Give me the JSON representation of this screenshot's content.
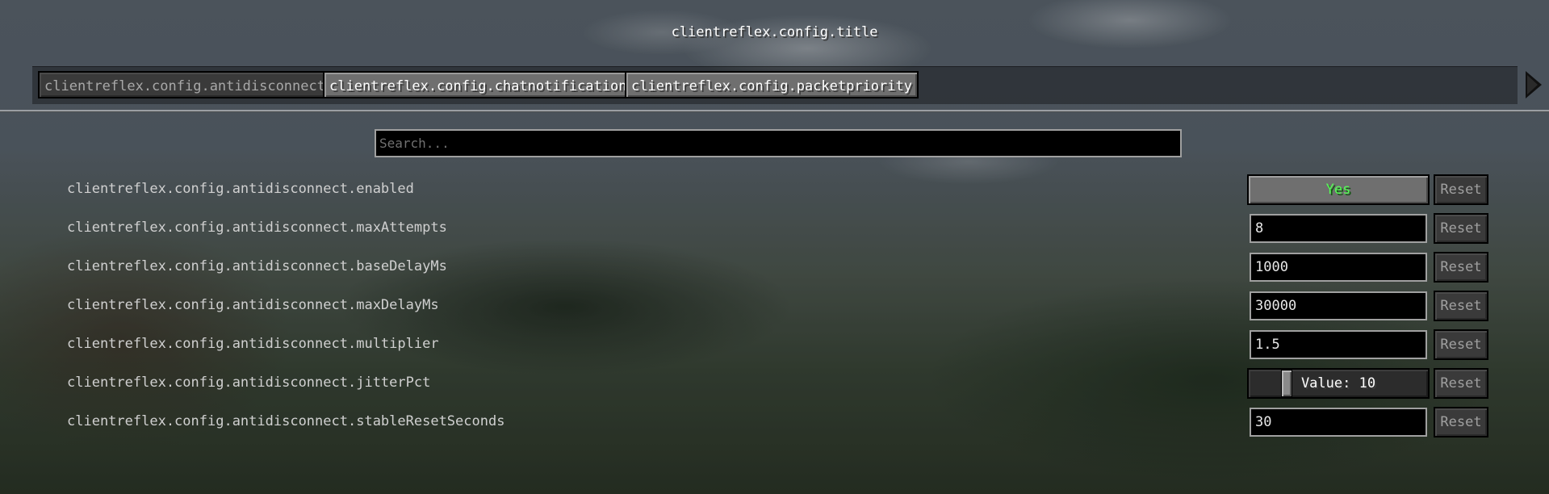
{
  "window": {
    "title": "clientreflex.config.title"
  },
  "tabs": [
    {
      "label": "clientreflex.config.antidisconnect",
      "active": true
    },
    {
      "label": "clientreflex.config.chatnotifications",
      "active": false
    },
    {
      "label": "clientreflex.config.packetpriority",
      "active": false
    }
  ],
  "search": {
    "placeholder": "Search...",
    "value": ""
  },
  "options": [
    {
      "label": "clientreflex.config.antidisconnect.enabled",
      "type": "toggle",
      "value": "Yes",
      "reset": "Reset"
    },
    {
      "label": "clientreflex.config.antidisconnect.maxAttempts",
      "type": "field",
      "value": "8",
      "reset": "Reset"
    },
    {
      "label": "clientreflex.config.antidisconnect.baseDelayMs",
      "type": "field",
      "value": "1000",
      "reset": "Reset"
    },
    {
      "label": "clientreflex.config.antidisconnect.maxDelayMs",
      "type": "field",
      "value": "30000",
      "reset": "Reset"
    },
    {
      "label": "clientreflex.config.antidisconnect.multiplier",
      "type": "field",
      "value": "1.5",
      "reset": "Reset"
    },
    {
      "label": "clientreflex.config.antidisconnect.jitterPct",
      "type": "slider",
      "value": "Value: 10",
      "reset": "Reset"
    },
    {
      "label": "clientreflex.config.antidisconnect.stableResetSeconds",
      "type": "field",
      "value": "30",
      "reset": "Reset"
    }
  ],
  "colors": {
    "toggle_on": "#55ff55"
  },
  "icons": {
    "tab_scroll": "chevron-right-icon"
  }
}
